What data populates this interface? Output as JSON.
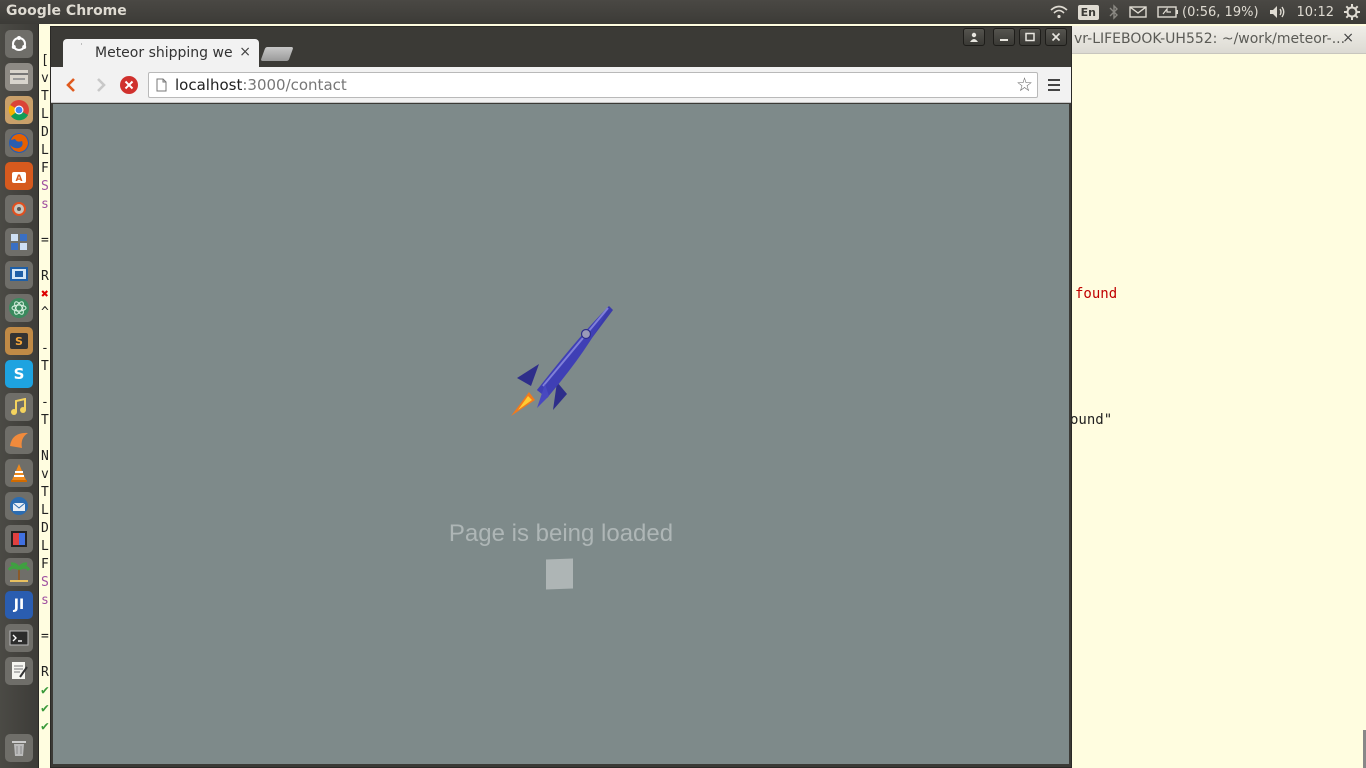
{
  "top_panel": {
    "app_title": "Google Chrome",
    "keyboard_layout": "En",
    "battery": "(0:56, 19%)",
    "time": "10:12",
    "icons": [
      "wifi-icon",
      "bluetooth-icon",
      "mail-icon",
      "battery-icon",
      "volume-icon",
      "gear-icon"
    ]
  },
  "launcher": {
    "items": [
      "ubuntu-dash-icon",
      "files-icon",
      "chrome-icon",
      "firefox-icon",
      "software-center-icon",
      "settings-icon",
      "workspace-icon",
      "virtualbox-icon",
      "atom-icon",
      "sublime-text-icon",
      "skype-icon",
      "music-icon",
      "orange-icon",
      "vlc-icon",
      "thunderbird-icon",
      "image-icon",
      "palm-icon",
      "jetbrains-icon",
      "terminal-icon",
      "text-editor-icon",
      "trash-icon"
    ]
  },
  "background_terminal": {
    "title": "vr-LIFEBOOK-UH552: ~/work/meteor-...",
    "close_label": "×",
    "line_1": "found",
    "line_2": "ound\"",
    "left_strip_chars": [
      "[",
      "v",
      "T",
      "L",
      "D",
      "L",
      "F",
      "S",
      "s",
      "",
      "=",
      "",
      "R",
      "✖",
      "^",
      "",
      "-",
      "T",
      "",
      "-",
      "T",
      "",
      "N",
      "v",
      "T",
      "L",
      "D",
      "L",
      "F",
      "S",
      "s",
      "",
      "=",
      "",
      "R",
      "✔",
      "✔",
      "✔"
    ]
  },
  "browser": {
    "tab_title": "Meteor shipping we",
    "tab_close": "×",
    "url_host": "localhost",
    "url_path": ":3000/contact",
    "window_buttons": [
      "profile-icon",
      "minimize-icon",
      "maximize-icon",
      "close-icon"
    ]
  },
  "page": {
    "loading_text": "Page is being loaded",
    "background_color": "#7e8a8a"
  }
}
